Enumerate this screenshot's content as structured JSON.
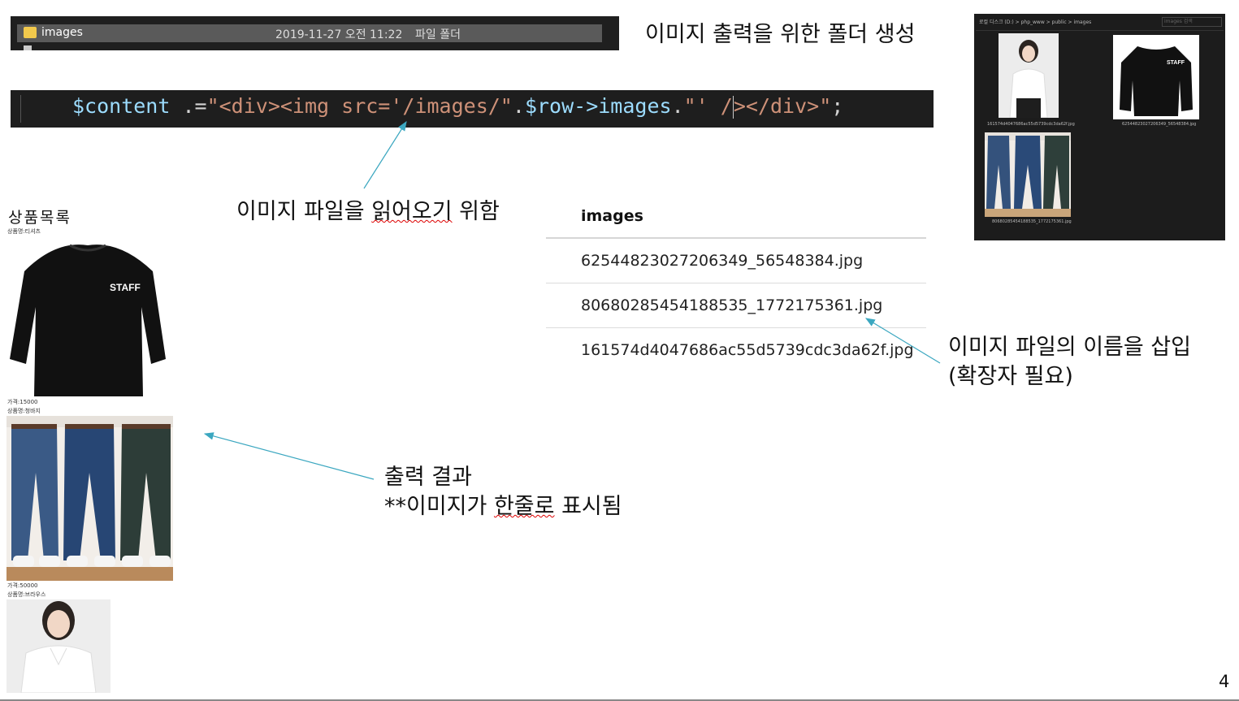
{
  "explorer": {
    "folder_name": "images",
    "folder_date": "2019-11-27 오전 11:22",
    "folder_type": "파일 폴더"
  },
  "code": {
    "var1": "$content",
    "op": " .=",
    "str1": "\"<div><img src='/images/\"",
    "dot1": ".",
    "var2": "$row->images",
    "dot2": ".",
    "str2": "\"' /",
    "str3": "></div>\"",
    "end": ";"
  },
  "annotations": {
    "folder_title": "이미지 출력을 위한 폴더 생성",
    "read_prefix": "이미지 파일을 ",
    "read_squiggle": "읽어오기",
    "read_suffix": " 위함",
    "insert_line1": "이미지 파일의 이름을 삽입",
    "insert_line2": "(확장자 필요)",
    "result_line1": "출력 결과",
    "result_line2_prefix": "**이미지가 ",
    "result_line2_squiggle": "한줄로",
    "result_line2_suffix": " 표시됨"
  },
  "folder_preview": {
    "path": "로컬 디스크 (D:)  >  php_www  >  public  >  images",
    "search_placeholder": "images 검색",
    "files": [
      "161574d4047686ac55d5739cdc3da62f.jpg",
      "62544823027206349_56548384.jpg",
      "80680285454188535_1772175361.jpg"
    ]
  },
  "table": {
    "header": "images",
    "rows": [
      "62544823027206349_56548384.jpg",
      "80680285454188535_1772175361.jpg",
      "161574d4047686ac55d5739cdc3da62f.jpg"
    ]
  },
  "product_list": {
    "title": "상품목록",
    "items": [
      {
        "name_label": "상품명:티셔츠",
        "price_label": "가격:15000",
        "image_text": "STAFF"
      },
      {
        "name_label": "상품명:청바지",
        "price_label": "가격:50000"
      },
      {
        "name_label": "상품명:브라우스"
      }
    ]
  },
  "slide_number": "4",
  "colors": {
    "code_bg": "#1e1e1e",
    "code_var": "#9cdcfe",
    "code_str": "#ce9178",
    "arrow": "#3ba7c0",
    "explorer_row": "#5a5a5a"
  }
}
